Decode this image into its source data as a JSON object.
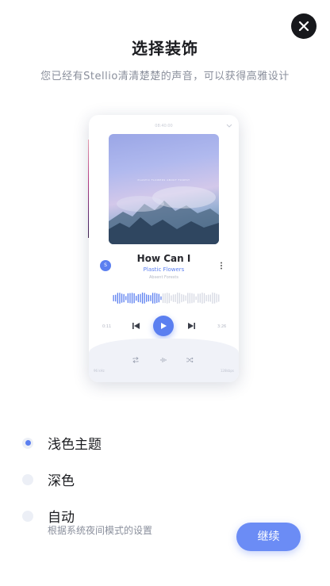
{
  "header": {
    "title": "选择装饰",
    "subtitle": "您已经有Stellio清清楚楚的声音，可以获得高雅设计"
  },
  "preview": {
    "top_time": "08:40:00",
    "album_art_text": "PLASTIC FLOWERS ABOUT FOREST",
    "song_title": "How Can I",
    "artist": "Plastic Flowers",
    "album": "Absent Forests",
    "badge": "S",
    "time_elapsed": "0:11",
    "time_total": "3:26",
    "footer_left": "96 kHz",
    "footer_right": "128kbps",
    "accent_color": "#5b7ff0"
  },
  "options": [
    {
      "label": "浅色主题",
      "selected": true
    },
    {
      "label": "深色",
      "selected": false
    },
    {
      "label": "自动",
      "selected": false,
      "description": "根据系统夜间模式的设置"
    }
  ],
  "actions": {
    "continue_label": "继续",
    "close_icon": "close-icon"
  }
}
